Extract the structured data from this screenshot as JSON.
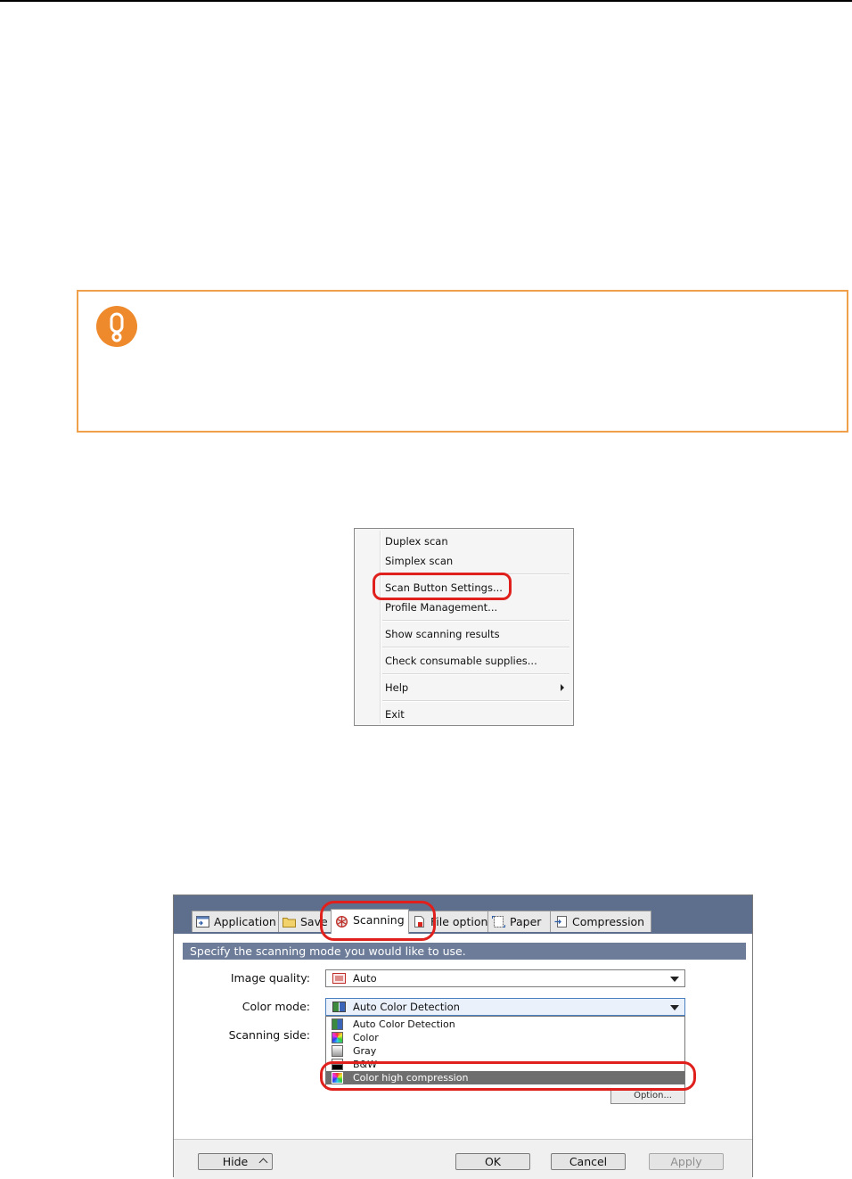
{
  "context_menu": {
    "items": [
      {
        "label": "Duplex scan"
      },
      {
        "label": "Simplex scan"
      },
      {
        "label": "Scan Button Settings..."
      },
      {
        "label": "Profile Management..."
      },
      {
        "label": "Show scanning results"
      },
      {
        "label": "Check consumable supplies..."
      },
      {
        "label": "Help",
        "has_submenu": true
      },
      {
        "label": "Exit"
      }
    ],
    "highlighted_item": "Scan Button Settings..."
  },
  "dialog": {
    "tabs": [
      {
        "label": "Application",
        "icon": "application-tab-icon"
      },
      {
        "label": "Save",
        "icon": "save-folder-icon"
      },
      {
        "label": "Scanning",
        "icon": "scanning-tab-icon",
        "active": true
      },
      {
        "label": "File option",
        "icon": "file-option-icon"
      },
      {
        "label": "Paper",
        "icon": "paper-tab-icon"
      },
      {
        "label": "Compression",
        "icon": "compression-tab-icon"
      }
    ],
    "banner": "Specify the scanning mode you would like to use.",
    "image_quality": {
      "label": "Image quality:",
      "value": "Auto"
    },
    "color_mode": {
      "label": "Color mode:",
      "value": "Auto Color Detection",
      "options": [
        {
          "label": "Auto Color Detection"
        },
        {
          "label": "Color"
        },
        {
          "label": "Gray"
        },
        {
          "label": "B&W"
        },
        {
          "label": "Color high compression",
          "selected": true
        }
      ]
    },
    "scanning_side": {
      "label": "Scanning side:"
    },
    "hidden_button": {
      "label": "Option..."
    },
    "buttons": {
      "hide": "Hide",
      "ok": "OK",
      "cancel": "Cancel",
      "apply": "Apply"
    }
  },
  "colors": {
    "caution_border": "#f0a04a",
    "caution_icon": "#ee8a2c",
    "highlight_ring": "#e0201c",
    "dialog_header": "#5e6f8e",
    "banner": "#6d7c99"
  }
}
